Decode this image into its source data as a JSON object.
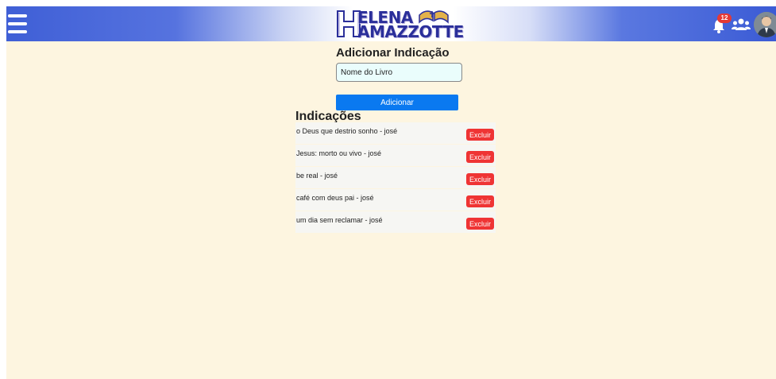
{
  "header": {
    "logo_line1": "ELENA",
    "logo_line2": "AMAZZOTTE",
    "notification_count": "12",
    "colors": {
      "bar_blue": "#3f5fd6",
      "logo_text": "#2b2f9a",
      "badge": "#e53935"
    },
    "icons": [
      "menu-icon",
      "bell-icon",
      "users-icon",
      "avatar"
    ]
  },
  "form": {
    "title": "Adicionar Indicação",
    "input_value": "Nome do Livro",
    "submit_label": "Adicionar",
    "submit_color": "#0a79f0"
  },
  "list": {
    "title": "Indicações",
    "delete_label": "Excluir",
    "delete_color": "#ef3434",
    "items": [
      {
        "text": "o Deus que destrio sonho - josé"
      },
      {
        "text": "Jesus: morto ou vivo - josé"
      },
      {
        "text": "be real - josé"
      },
      {
        "text": "café com deus pai - josé"
      },
      {
        "text": "um dia sem reclamar - josé"
      }
    ]
  }
}
